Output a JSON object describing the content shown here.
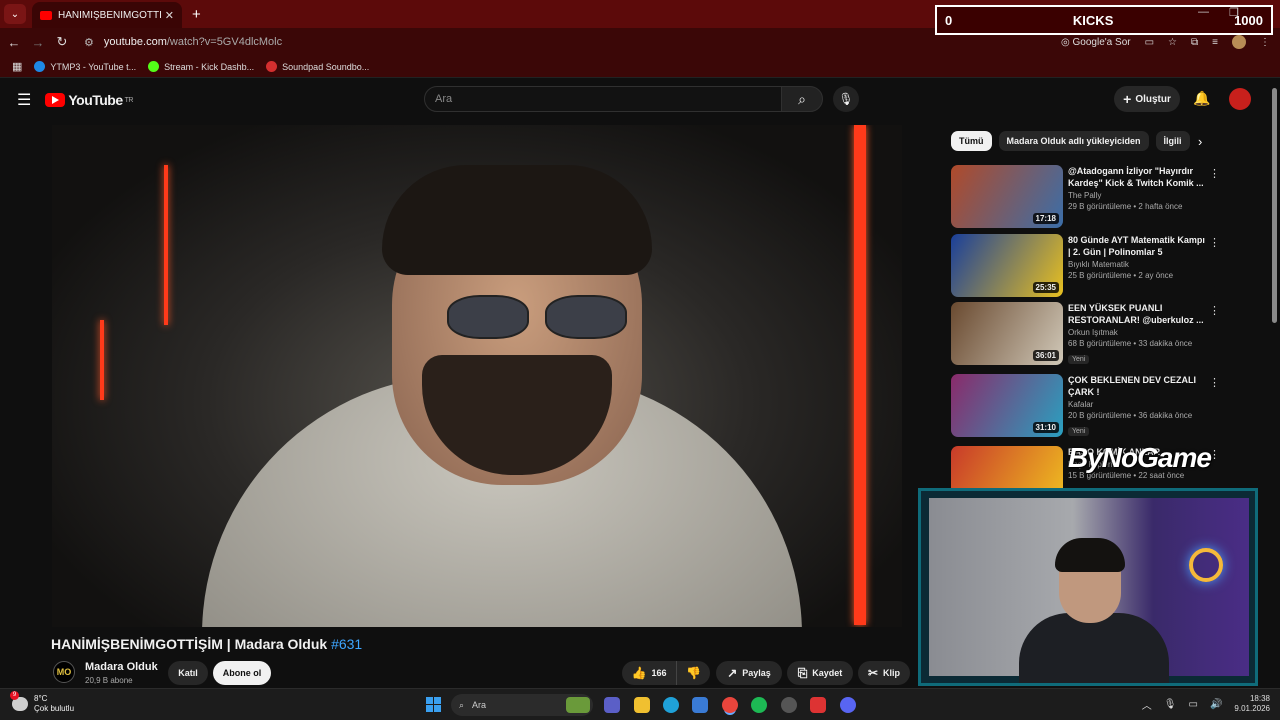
{
  "browser": {
    "tab_title": "HANİMİŞBENİMGOTTİŞİM | Ma",
    "tab_close": "✕",
    "new_tab": "+",
    "address_site": "youtube.com",
    "address_path": "/watch?v=5GV4dlcMolc",
    "google_ask": "Google'a Sor",
    "bookmarks": [
      {
        "label": "YTMP3 - YouTube t...",
        "color": "#1e88e5"
      },
      {
        "label": "Stream - Kick Dashb...",
        "color": "#53fc18"
      },
      {
        "label": "Soundpad Soundbo...",
        "color": "#d32f2f"
      }
    ]
  },
  "overlay": {
    "kicks_left": "0",
    "kicks_label": "KICKS",
    "kicks_right": "1000",
    "watermark": "ByNoGame"
  },
  "youtube": {
    "logo_text": "YouTube",
    "region": "TR",
    "search_placeholder": "Ara",
    "create_label": "Oluştur"
  },
  "video": {
    "title": "HANİMİŞBENİMGOTTİŞİM | Madara Olduk",
    "episode": "#631",
    "channel_initials": "MO",
    "channel_name": "Madara Olduk",
    "subscribers": "20,9 B abone",
    "join_label": "Katıl",
    "subscribe_label": "Abone ol",
    "likes": "166",
    "share_label": "Paylaş",
    "save_label": "Kaydet",
    "clip_label": "Klip"
  },
  "chips": [
    "Tümü",
    "Madara Olduk adlı yükleyiciden",
    "İlgili"
  ],
  "recommendations": [
    {
      "title": "@Atadogann İzliyor \"Hayırdır Kardeş\" Kick & Twitch Komik ...",
      "channel": "The Pally",
      "meta": "29 B görüntüleme • 2 hafta önce",
      "duration": "17:18",
      "new": "",
      "c1": "#b04a2a",
      "c2": "#3b6ea8"
    },
    {
      "title": "80 Günde AYT Matematik Kampı | 2. Gün | Polinomlar 5",
      "channel": "Bıyıklı Matematik",
      "meta": "25 B görüntüleme • 2 ay önce",
      "duration": "25:35",
      "new": "",
      "c1": "#1a3f9a",
      "c2": "#e8c020"
    },
    {
      "title": "EEN YÜKSEK PUANLI RESTORANLAR! @uberkuloz ...",
      "channel": "Orkun Işıtmak",
      "meta": "68 B görüntüleme • 33 dakika önce",
      "duration": "36:01",
      "new": "Yeni",
      "c1": "#6a4a30",
      "c2": "#d0c8b8"
    },
    {
      "title": "ÇOK BEKLENEN DEV CEZALI ÇARK !",
      "channel": "Kafalar",
      "meta": "20 B görüntüleme • 36 dakika önce",
      "duration": "31:10",
      "new": "Yeni",
      "c1": "#8a2a6a",
      "c2": "#2aa0c0"
    },
    {
      "title": "BAŞO KOMİK ANLAR",
      "channel": "Başo Klipleri",
      "meta": "15 B görüntüleme • 22 saat önce",
      "duration": "",
      "new": "",
      "c1": "#c83a2a",
      "c2": "#f0c020"
    }
  ],
  "taskbar": {
    "temp": "8°C",
    "weather": "Çok bulutlu",
    "weather_badge": "9",
    "search": "Ara",
    "time": "18:38",
    "date": "9.01.2026"
  }
}
